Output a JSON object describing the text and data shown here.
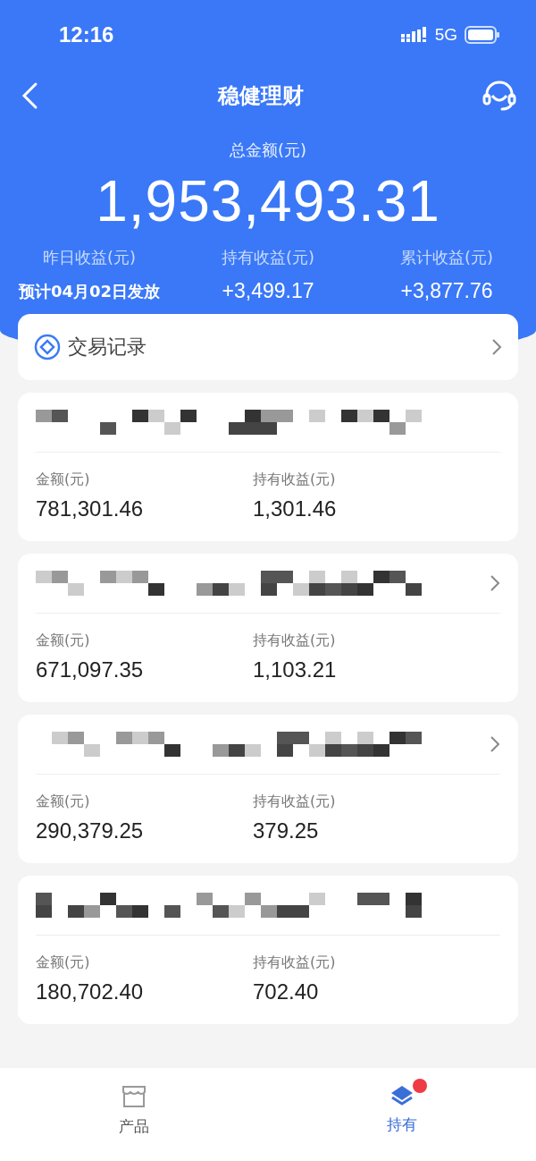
{
  "status_bar": {
    "time": "12:16",
    "network": "5G"
  },
  "header": {
    "title": "稳健理财"
  },
  "summary": {
    "total_label": "总金额(元)",
    "total": "1,953,493.31",
    "stats": [
      {
        "label": "昨日收益(元)",
        "value": "预计04月02日发放"
      },
      {
        "label": "持有收益(元)",
        "value": "+3,499.17"
      },
      {
        "label": "累计收益(元)",
        "value": "+3,877.76"
      }
    ]
  },
  "records_link": {
    "label": "交易记录"
  },
  "holdings": [
    {
      "chevron": false,
      "amount_label": "金额(元)",
      "amount": "781,301.46",
      "income_label": "持有收益(元)",
      "income": "1,301.46"
    },
    {
      "chevron": true,
      "amount_label": "金额(元)",
      "amount": "671,097.35",
      "income_label": "持有收益(元)",
      "income": "1,103.21"
    },
    {
      "chevron": true,
      "amount_label": "金额(元)",
      "amount": "290,379.25",
      "income_label": "持有收益(元)",
      "income": "379.25"
    },
    {
      "chevron": false,
      "amount_label": "金额(元)",
      "amount": "180,702.40",
      "income_label": "持有收益(元)",
      "income": "702.40"
    }
  ],
  "tab_bar": [
    {
      "label": "产品",
      "selected": false,
      "kind": "store",
      "badge": false
    },
    {
      "label": "持有",
      "selected": true,
      "kind": "layers",
      "badge": true
    }
  ]
}
